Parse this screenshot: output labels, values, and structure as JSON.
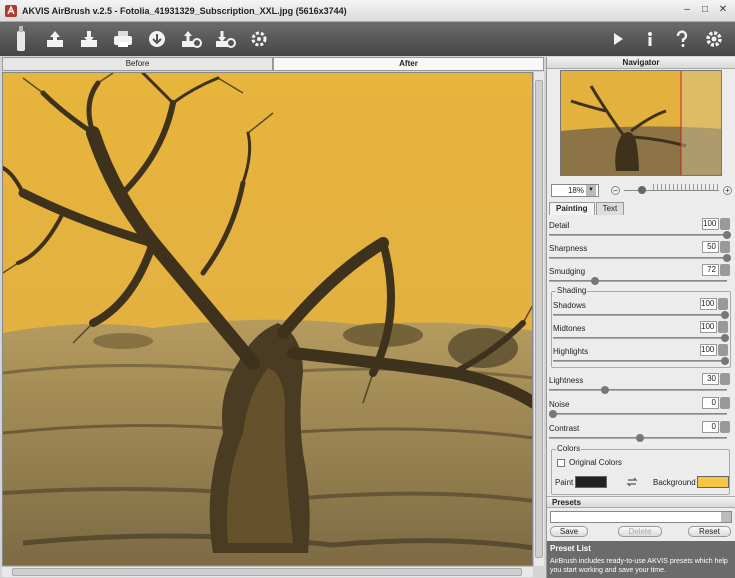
{
  "window": {
    "title": "AKVIS AirBrush v.2.5 - Fotolia_41931329_Subscription_XXL.jpg (5616x3744)",
    "minimize": "–",
    "maximize": "□",
    "close": "✕"
  },
  "toolbar": {
    "left_icons": [
      "open-icon",
      "save-icon",
      "print-icon",
      "share-icon",
      "import-presets-icon",
      "export-presets-icon",
      "batch-settings-icon"
    ],
    "right_icons": [
      "run-icon",
      "info-icon",
      "help-icon",
      "preferences-icon"
    ]
  },
  "view_tabs": {
    "before": "Before",
    "after": "After"
  },
  "navigator": {
    "title": "Navigator",
    "zoom": "18%",
    "zoom_minus": "–",
    "zoom_plus": "+"
  },
  "settings_tabs": {
    "painting": "Painting",
    "text": "Text"
  },
  "params": {
    "detail": {
      "label": "Detail",
      "value": "100",
      "fraction": 1.0
    },
    "sharpness": {
      "label": "Sharpness",
      "value": "50",
      "fraction": 1.0
    },
    "smudging": {
      "label": "Smudging",
      "value": "72",
      "fraction": 0.24
    },
    "shading": {
      "label": "Shading"
    },
    "shadows": {
      "label": "Shadows",
      "value": "100",
      "fraction": 1.0
    },
    "midtones": {
      "label": "Midtones",
      "value": "100",
      "fraction": 1.0
    },
    "highlights": {
      "label": "Highlights",
      "value": "100",
      "fraction": 1.0
    },
    "lightness": {
      "label": "Lightness",
      "value": "30",
      "fraction": 0.3
    },
    "noise": {
      "label": "Noise",
      "value": "0",
      "fraction": 0.0
    },
    "contrast": {
      "label": "Contrast",
      "value": "0",
      "fraction": 0.5
    }
  },
  "colors": {
    "group_label": "Colors",
    "original_colors": "Original Colors",
    "paint_label": "Paint",
    "background_label": "Background",
    "paint_color": "#222222",
    "background_color": "#f5c544"
  },
  "presets": {
    "title": "Presets",
    "save": "Save",
    "delete": "Delete",
    "reset": "Reset",
    "list_title": "Preset List",
    "list_text": "AirBrush includes ready-to-use AKVIS presets which help you start working and save your time."
  }
}
